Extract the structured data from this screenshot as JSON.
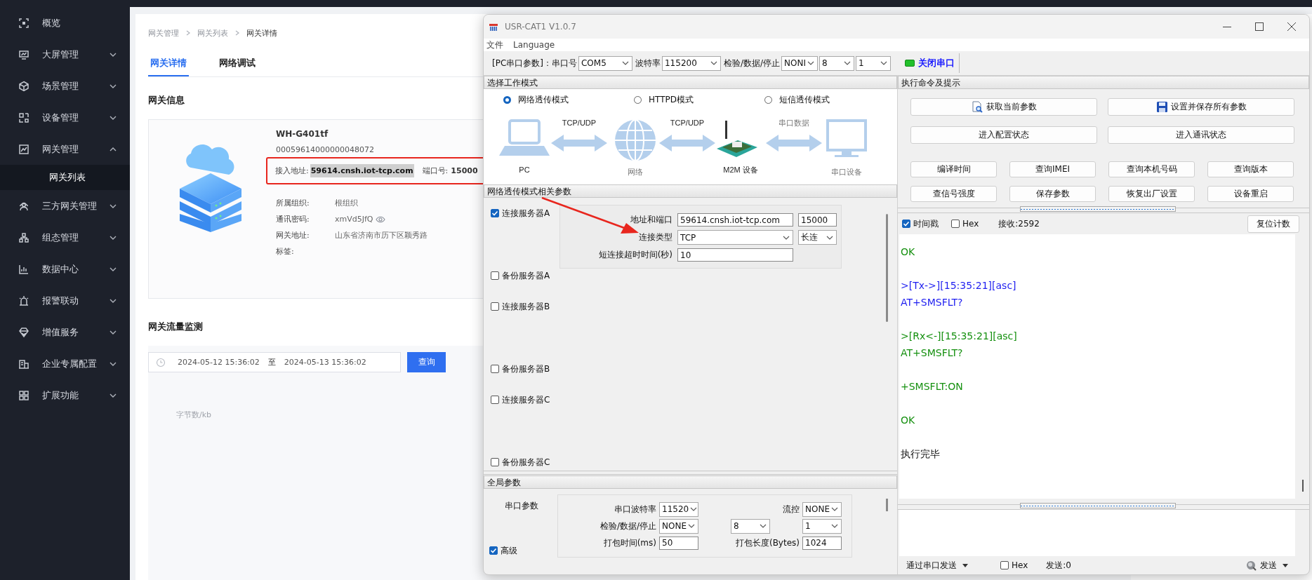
{
  "sidebar": {
    "items": [
      {
        "label": "概览",
        "kind": "link",
        "selected": false
      },
      {
        "label": "大屏管理",
        "kind": "group",
        "expanded": false,
        "selected": false
      },
      {
        "label": "场景管理",
        "kind": "group",
        "expanded": false,
        "selected": false
      },
      {
        "label": "设备管理",
        "kind": "group",
        "expanded": false,
        "selected": false
      },
      {
        "label": "网关管理",
        "kind": "group",
        "expanded": true,
        "selected": false,
        "children": [
          {
            "label": "网关列表",
            "selected": true
          }
        ]
      },
      {
        "label": "三方网关管理",
        "kind": "group",
        "expanded": false,
        "selected": false
      },
      {
        "label": "组态管理",
        "kind": "group",
        "expanded": false,
        "selected": false
      },
      {
        "label": "数据中心",
        "kind": "group",
        "expanded": false,
        "selected": false
      },
      {
        "label": "报警联动",
        "kind": "group",
        "expanded": false,
        "selected": false
      },
      {
        "label": "增值服务",
        "kind": "group",
        "expanded": false,
        "selected": false
      },
      {
        "label": "企业专属配置",
        "kind": "group",
        "expanded": false,
        "selected": false
      },
      {
        "label": "扩展功能",
        "kind": "group",
        "expanded": false,
        "selected": false
      }
    ]
  },
  "breadcrumb": [
    "网关管理",
    "网关列表",
    "网关详情"
  ],
  "tabs": [
    {
      "label": "网关详情",
      "selected": true
    },
    {
      "label": "网络调试",
      "selected": false
    }
  ],
  "gateway_info": {
    "title": "网关信息",
    "name": "WH-G401tf",
    "serial": "00059614000000048072",
    "address_label": "接入地址:",
    "address": "59614.cnsh.iot-tcp.com",
    "port_label": "端口号:",
    "port": "15000",
    "fields": [
      {
        "label": "所属组织:",
        "value": "根组织"
      },
      {
        "label": "通讯密码:",
        "value": "xmVd5JfQ",
        "kind": "password"
      },
      {
        "label": "网关地址:",
        "value": "山东省济南市历下区颖秀路"
      },
      {
        "label": "标签:"
      }
    ]
  },
  "traffic": {
    "title": "网关流量监测",
    "start": "2024-05-12 15:36:02",
    "separator": "至",
    "end": "2024-05-13 15:36:02",
    "query_button": "查询",
    "axis_label": "字节数/kb"
  },
  "app_window": {
    "title": "USR-CAT1 V1.0.7",
    "menu": [
      "文件",
      "Language"
    ],
    "serial_bar": {
      "port_label": "[PC串口参数]：串口号",
      "port": "COM5",
      "baud_label": "波特率",
      "baud": "115200",
      "format_label": "检验/数据/停止",
      "parity": "NONI",
      "data_bits": "8",
      "stop_bits": "1",
      "toggle": "关闭串口",
      "connected": true
    },
    "mode_panel": {
      "title": "选择工作模式",
      "modes": [
        {
          "label": "网络透传模式",
          "selected": true
        },
        {
          "label": "HTTPD模式",
          "selected": false
        },
        {
          "label": "短信透传模式",
          "selected": false
        }
      ],
      "diagram": {
        "nodes": [
          "PC",
          "网络",
          "M2M 设备",
          "串口设备"
        ],
        "links": [
          "TCP/UDP",
          "TCP/UDP",
          "串口数据"
        ]
      }
    },
    "network_panel": {
      "title": "网络透传模式相关参数",
      "servers": [
        {
          "label": "连接服务器A",
          "kind": "primary",
          "checked": true,
          "settings": {
            "address_label": "地址和端口",
            "address": "59614.cnsh.iot-tcp.com",
            "port": "15000",
            "type_label": "连接类型",
            "type": "TCP",
            "mode": "长连",
            "timeout_label": "短连接超时时间(秒)",
            "timeout": "10"
          }
        },
        {
          "label": "备份服务器A",
          "kind": "backup",
          "checked": false
        },
        {
          "label": "连接服务器B",
          "kind": "primary",
          "checked": false
        },
        {
          "label": "备份服务器B",
          "kind": "backup",
          "checked": false
        },
        {
          "label": "连接服务器C",
          "kind": "primary",
          "checked": false
        },
        {
          "label": "备份服务器C",
          "kind": "backup",
          "checked": false
        }
      ]
    },
    "global_panel": {
      "title": "全局参数",
      "group_label": "串口参数",
      "baud": {
        "label": "串口波特率",
        "value": "11520"
      },
      "flow": {
        "label": "流控",
        "value": "NONE"
      },
      "format": {
        "label": "检验/数据/停止",
        "parity": "NONE",
        "data_bits": "8",
        "stop_bits": "1"
      },
      "pack_time": {
        "label": "打包时间(ms)",
        "value": "50"
      },
      "pack_length": {
        "label": "打包长度(Bytes)",
        "value": "1024"
      },
      "advanced": {
        "label": "高级",
        "checked": true
      }
    },
    "command_panel": {
      "title": "执行命令及提示",
      "main_buttons": [
        "获取当前参数",
        "设置并保存所有参数",
        "进入配置状态",
        "进入通讯状态"
      ],
      "buttons": [
        "编译时间",
        "查询IMEI",
        "查询本机号码",
        "查询版本",
        "查信号强度",
        "保存参数",
        "恢复出厂设置",
        "设备重启"
      ]
    },
    "log": {
      "timestamp": {
        "label": "时间戳",
        "checked": true
      },
      "hex": {
        "label": "Hex",
        "checked": false
      },
      "received": "接收:2592",
      "reset_button": "复位计数",
      "entries": [
        {
          "kind": "rx",
          "lines": [
            "OK"
          ]
        },
        {
          "kind": "tx",
          "lines": [
            ">[Tx->][15:35:21][asc]",
            "AT+SMSFLT?"
          ]
        },
        {
          "kind": "rx",
          "lines": [
            ">[Rx<-][15:35:21][asc]",
            "AT+SMSFLT?"
          ]
        },
        {
          "kind": "rx",
          "lines": [
            "+SMSFLT:ON"
          ]
        },
        {
          "kind": "rx",
          "lines": [
            "OK"
          ]
        },
        {
          "kind": "info",
          "lines": [
            "执行完毕"
          ]
        }
      ]
    },
    "send": {
      "channel": "通过串口发送",
      "hex": {
        "label": "Hex",
        "checked": false
      },
      "sent": "发送:0",
      "send_button": "发送"
    }
  }
}
